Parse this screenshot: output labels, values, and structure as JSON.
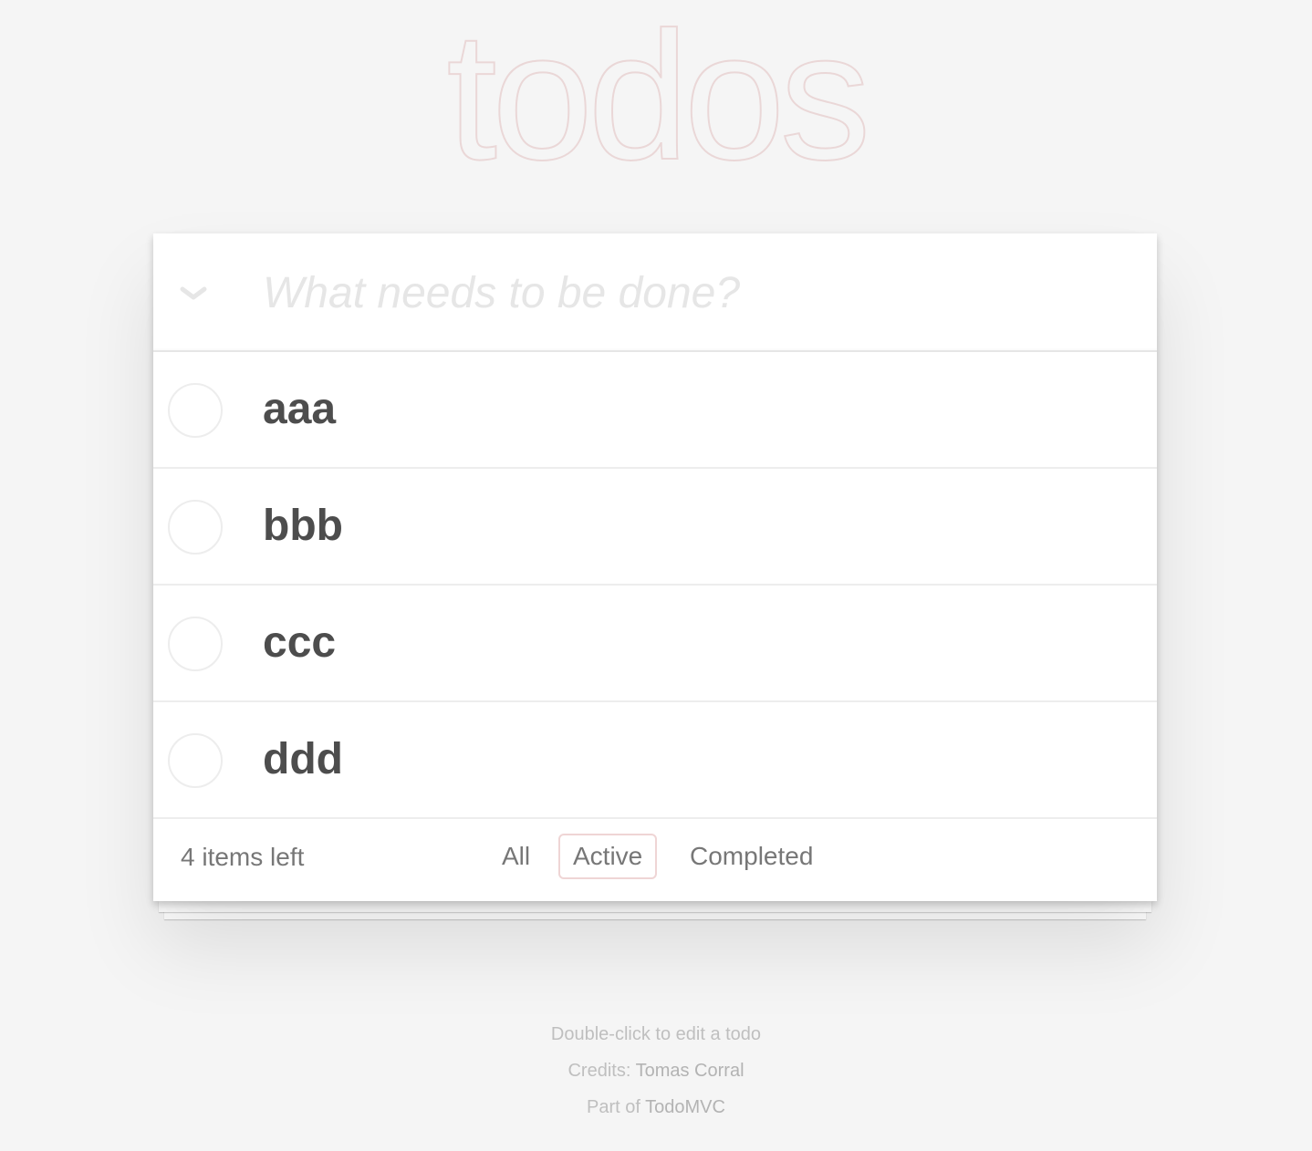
{
  "header": {
    "title": "todos",
    "input_placeholder": "What needs to be done?",
    "toggle_all_icon": "chevron-down-icon"
  },
  "todos": [
    {
      "label": "aaa",
      "completed": false
    },
    {
      "label": "bbb",
      "completed": false
    },
    {
      "label": "ccc",
      "completed": false
    },
    {
      "label": "ddd",
      "completed": false
    }
  ],
  "footer": {
    "count_text": "4 items left",
    "filters": [
      {
        "label": "All",
        "selected": false
      },
      {
        "label": "Active",
        "selected": true
      },
      {
        "label": "Completed",
        "selected": false
      }
    ]
  },
  "info": {
    "hint": "Double-click to edit a todo",
    "credits_prefix": "Credits: ",
    "credits_name": "Tomas Corral",
    "part_prefix": "Part of ",
    "part_name": "TodoMVC"
  },
  "colors": {
    "background": "#f5f5f5",
    "title": "#efd9d9",
    "text": "#4d4d4d",
    "selected_filter_border": "#efd5d5"
  }
}
